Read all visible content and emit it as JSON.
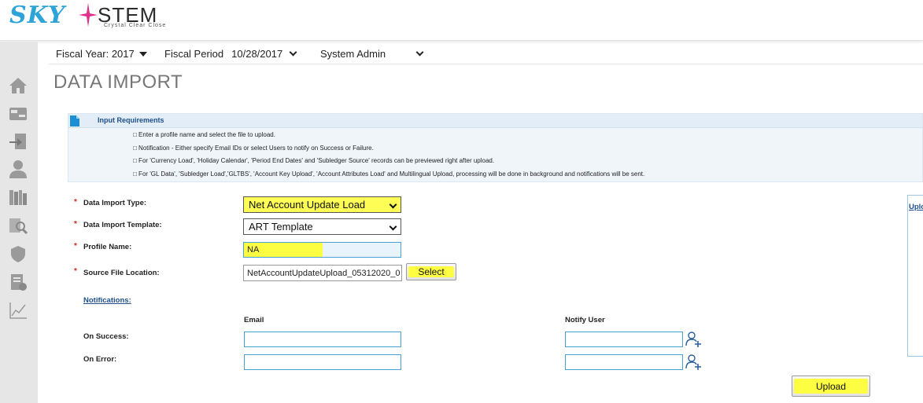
{
  "logo": {
    "sky": "SKY",
    "stem": "STEM",
    "tagline": "Crystal Clear Close"
  },
  "context": {
    "fiscal_year": "Fiscal Year: 2017",
    "fiscal_period_label": "Fiscal Period",
    "fiscal_period_value": "10/28/2017",
    "role": "System Admin"
  },
  "page": {
    "title": "DATA IMPORT"
  },
  "requirements": {
    "title": "Input Requirements",
    "lines": [
      "□ Enter a profile name and select the file to upload.",
      "□ Notification - Either specify Email IDs or select Users to notify on Success or Failure.",
      "□ For 'Currency Load', 'Holiday Calendar', 'Period End Dates' and 'Subledger Source' records can be previewed right after upload.",
      "□ For 'GL Data', 'Subledger Load','GLTBS', 'Account Key Upload', 'Account Attributes Load' and Multilingual Upload, processing will be done in background and notifications will be sent."
    ]
  },
  "form": {
    "required_mark": "*",
    "import_type_label": "Data Import Type:",
    "import_type_value": "Net Account Update Load",
    "template_label": "Data Import Template:",
    "template_value": "ART Template",
    "profile_label": "Profile Name:",
    "profile_value": "NA",
    "source_label": "Source File Location:",
    "source_value": "NetAccountUpdateUpload_05312020_0",
    "select_button": "Select"
  },
  "notifications": {
    "link": "Notifications:",
    "email_header": "Email",
    "notify_user_header": "Notify User",
    "on_success_label": "On Success:",
    "on_error_label": "On Error:",
    "success_email": "",
    "error_email": "",
    "success_user": "",
    "error_user": ""
  },
  "actions": {
    "upload_button": "Upload"
  },
  "right_panel": {
    "label": "Uplo"
  },
  "colors": {
    "accent": "#1e4f8a",
    "highlight": "#fdfd42",
    "input_border": "#4a9fd5",
    "sidebar": "#e6e6e6"
  },
  "icons": [
    "home-icon",
    "card-icon",
    "import-icon",
    "user-icon",
    "library-icon",
    "report-search-icon",
    "shield-icon",
    "document-check-icon",
    "chart-line-icon",
    "user-add-icon",
    "document-icon"
  ]
}
